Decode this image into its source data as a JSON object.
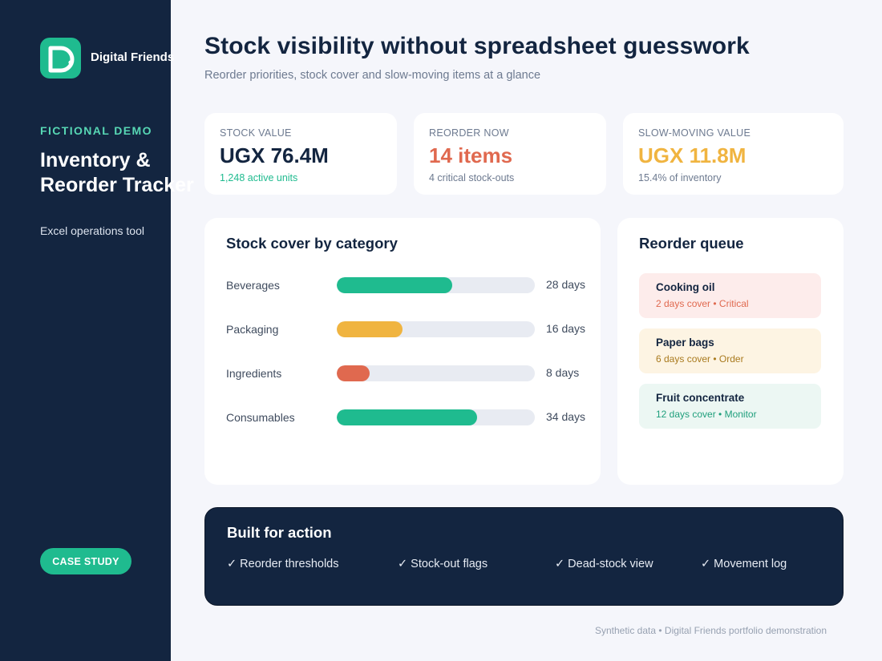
{
  "brand": {
    "name": "Digital Friends",
    "accent": "#1fbb8f",
    "sidebar_bg": "#132540"
  },
  "sidebar": {
    "eyebrow": "FICTIONAL DEMO",
    "title": "Inventory & Reorder Tracker",
    "subtitle": "Excel operations tool",
    "cta_label": "CASE STUDY"
  },
  "header": {
    "title": "Stock visibility without spreadsheet guesswork",
    "subtitle": "Reorder priorities, stock cover and slow-moving items at a glance"
  },
  "kpis": [
    {
      "label": "STOCK VALUE",
      "value": "UGX 76.4M",
      "note": "1,248 active units",
      "value_color": "#132540",
      "note_color": "#1fbb8f"
    },
    {
      "label": "REORDER NOW",
      "value": "14 items",
      "note": "4 critical stock-outs",
      "value_color": "#e0694f",
      "note_color": "#6d7a90"
    },
    {
      "label": "SLOW-MOVING VALUE",
      "value": "UGX 11.8M",
      "note": "15.4% of inventory",
      "value_color": "#f0b440",
      "note_color": "#6d7a90"
    }
  ],
  "stock_cover": {
    "title": "Stock cover by category",
    "rows": [
      {
        "name": "Beverages",
        "value_label": "28 days",
        "days": 28,
        "color": "#1fbb8f"
      },
      {
        "name": "Packaging",
        "value_label": "16 days",
        "days": 16,
        "color": "#f0b440"
      },
      {
        "name": "Ingredients",
        "value_label": "8 days",
        "days": 8,
        "color": "#e0694f"
      },
      {
        "name": "Consumables",
        "value_label": "34 days",
        "days": 34,
        "color": "#1fbb8f"
      }
    ]
  },
  "reorder_queue": {
    "title": "Reorder queue",
    "items": [
      {
        "name": "Cooking oil",
        "meta": "2 days cover • Critical",
        "bg": "#fdeceb",
        "meta_color": "#e0694f"
      },
      {
        "name": "Paper bags",
        "meta": "6 days cover • Order",
        "bg": "#fdf4e3",
        "meta_color": "#a97a1e"
      },
      {
        "name": "Fruit concentrate",
        "meta": "12 days cover • Monitor",
        "bg": "#ecf7f3",
        "meta_color": "#1f9f7c"
      }
    ]
  },
  "action": {
    "title": "Built for action",
    "items": [
      "✓ Reorder thresholds",
      "✓ Stock-out flags",
      "✓ Dead-stock view",
      "✓ Movement log"
    ]
  },
  "footer": "Synthetic data • Digital Friends portfolio demonstration"
}
